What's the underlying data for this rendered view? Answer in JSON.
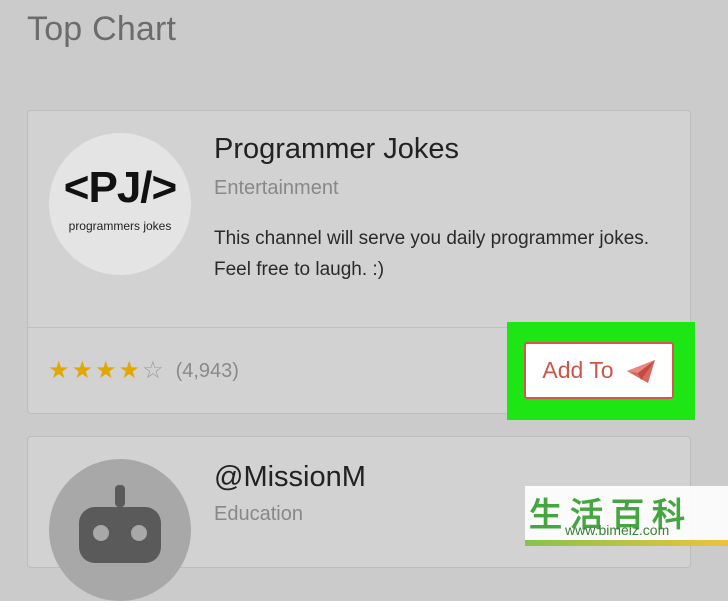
{
  "page": {
    "title": "Top Chart"
  },
  "cards": [
    {
      "name": "Programmer Jokes",
      "category": "Entertainment",
      "description": "This channel will serve you daily programmer jokes. Feel free to laugh. :)",
      "logo_text": "<PJ/>",
      "logo_caption": "programmers jokes",
      "rating": {
        "stars": 4,
        "max": 5,
        "count": "(4,943)"
      },
      "action_label": "Add To",
      "action_icon": "paper-plane-icon"
    },
    {
      "name": "@MissionM",
      "category": "Education",
      "avatar_icon": "robot-icon"
    }
  ],
  "watermark": {
    "chars": "生活百科",
    "url": "www.bimeiz.com"
  },
  "colors": {
    "accent": "#d9534f",
    "highlight": "#1ee614",
    "star": "#e0a800"
  }
}
